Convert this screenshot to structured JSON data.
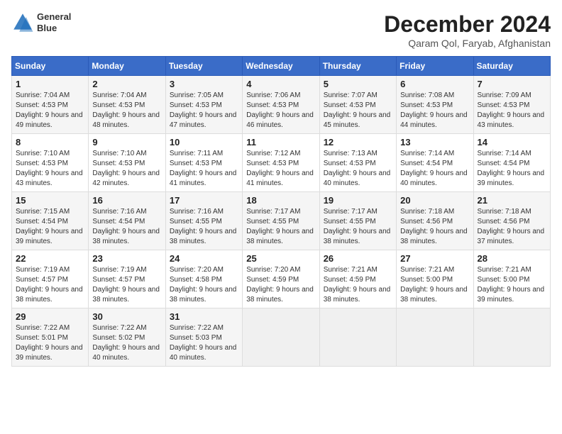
{
  "header": {
    "logo_line1": "General",
    "logo_line2": "Blue",
    "month": "December 2024",
    "location": "Qaram Qol, Faryab, Afghanistan"
  },
  "days_of_week": [
    "Sunday",
    "Monday",
    "Tuesday",
    "Wednesday",
    "Thursday",
    "Friday",
    "Saturday"
  ],
  "weeks": [
    [
      {
        "day": 1,
        "sunrise": "7:04 AM",
        "sunset": "4:53 PM",
        "daylight": "9 hours and 49 minutes."
      },
      {
        "day": 2,
        "sunrise": "7:04 AM",
        "sunset": "4:53 PM",
        "daylight": "9 hours and 48 minutes."
      },
      {
        "day": 3,
        "sunrise": "7:05 AM",
        "sunset": "4:53 PM",
        "daylight": "9 hours and 47 minutes."
      },
      {
        "day": 4,
        "sunrise": "7:06 AM",
        "sunset": "4:53 PM",
        "daylight": "9 hours and 46 minutes."
      },
      {
        "day": 5,
        "sunrise": "7:07 AM",
        "sunset": "4:53 PM",
        "daylight": "9 hours and 45 minutes."
      },
      {
        "day": 6,
        "sunrise": "7:08 AM",
        "sunset": "4:53 PM",
        "daylight": "9 hours and 44 minutes."
      },
      {
        "day": 7,
        "sunrise": "7:09 AM",
        "sunset": "4:53 PM",
        "daylight": "9 hours and 43 minutes."
      }
    ],
    [
      {
        "day": 8,
        "sunrise": "7:10 AM",
        "sunset": "4:53 PM",
        "daylight": "9 hours and 43 minutes."
      },
      {
        "day": 9,
        "sunrise": "7:10 AM",
        "sunset": "4:53 PM",
        "daylight": "9 hours and 42 minutes."
      },
      {
        "day": 10,
        "sunrise": "7:11 AM",
        "sunset": "4:53 PM",
        "daylight": "9 hours and 41 minutes."
      },
      {
        "day": 11,
        "sunrise": "7:12 AM",
        "sunset": "4:53 PM",
        "daylight": "9 hours and 41 minutes."
      },
      {
        "day": 12,
        "sunrise": "7:13 AM",
        "sunset": "4:53 PM",
        "daylight": "9 hours and 40 minutes."
      },
      {
        "day": 13,
        "sunrise": "7:14 AM",
        "sunset": "4:54 PM",
        "daylight": "9 hours and 40 minutes."
      },
      {
        "day": 14,
        "sunrise": "7:14 AM",
        "sunset": "4:54 PM",
        "daylight": "9 hours and 39 minutes."
      }
    ],
    [
      {
        "day": 15,
        "sunrise": "7:15 AM",
        "sunset": "4:54 PM",
        "daylight": "9 hours and 39 minutes."
      },
      {
        "day": 16,
        "sunrise": "7:16 AM",
        "sunset": "4:54 PM",
        "daylight": "9 hours and 38 minutes."
      },
      {
        "day": 17,
        "sunrise": "7:16 AM",
        "sunset": "4:55 PM",
        "daylight": "9 hours and 38 minutes."
      },
      {
        "day": 18,
        "sunrise": "7:17 AM",
        "sunset": "4:55 PM",
        "daylight": "9 hours and 38 minutes."
      },
      {
        "day": 19,
        "sunrise": "7:17 AM",
        "sunset": "4:55 PM",
        "daylight": "9 hours and 38 minutes."
      },
      {
        "day": 20,
        "sunrise": "7:18 AM",
        "sunset": "4:56 PM",
        "daylight": "9 hours and 38 minutes."
      },
      {
        "day": 21,
        "sunrise": "7:18 AM",
        "sunset": "4:56 PM",
        "daylight": "9 hours and 37 minutes."
      }
    ],
    [
      {
        "day": 22,
        "sunrise": "7:19 AM",
        "sunset": "4:57 PM",
        "daylight": "9 hours and 38 minutes."
      },
      {
        "day": 23,
        "sunrise": "7:19 AM",
        "sunset": "4:57 PM",
        "daylight": "9 hours and 38 minutes."
      },
      {
        "day": 24,
        "sunrise": "7:20 AM",
        "sunset": "4:58 PM",
        "daylight": "9 hours and 38 minutes."
      },
      {
        "day": 25,
        "sunrise": "7:20 AM",
        "sunset": "4:59 PM",
        "daylight": "9 hours and 38 minutes."
      },
      {
        "day": 26,
        "sunrise": "7:21 AM",
        "sunset": "4:59 PM",
        "daylight": "9 hours and 38 minutes."
      },
      {
        "day": 27,
        "sunrise": "7:21 AM",
        "sunset": "5:00 PM",
        "daylight": "9 hours and 38 minutes."
      },
      {
        "day": 28,
        "sunrise": "7:21 AM",
        "sunset": "5:00 PM",
        "daylight": "9 hours and 39 minutes."
      }
    ],
    [
      {
        "day": 29,
        "sunrise": "7:22 AM",
        "sunset": "5:01 PM",
        "daylight": "9 hours and 39 minutes."
      },
      {
        "day": 30,
        "sunrise": "7:22 AM",
        "sunset": "5:02 PM",
        "daylight": "9 hours and 40 minutes."
      },
      {
        "day": 31,
        "sunrise": "7:22 AM",
        "sunset": "5:03 PM",
        "daylight": "9 hours and 40 minutes."
      },
      null,
      null,
      null,
      null
    ]
  ]
}
